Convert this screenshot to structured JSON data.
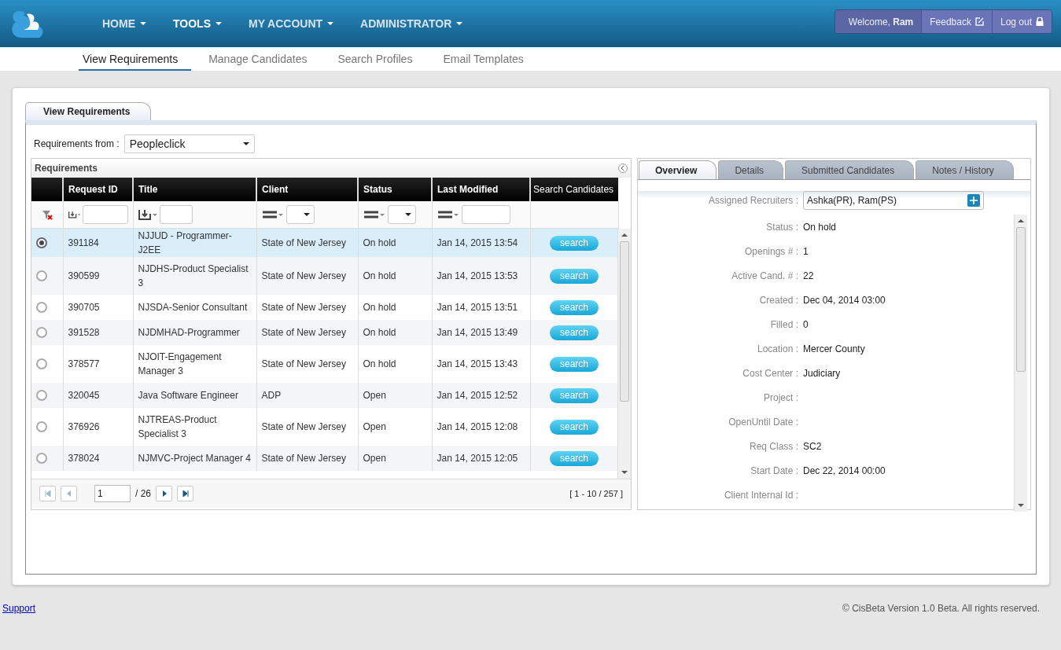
{
  "header": {
    "nav": [
      {
        "label": "HOME",
        "selected": false
      },
      {
        "label": "TOOLS",
        "selected": true
      },
      {
        "label": "MY ACCOUNT",
        "selected": false
      },
      {
        "label": "ADMINISTRATOR",
        "selected": false
      }
    ],
    "welcome": "Welcome, **Ram**",
    "feedback": "Feedback",
    "logout": "Log out"
  },
  "subnav": [
    {
      "label": "View Requirements",
      "selected": true
    },
    {
      "label": "Manage Candidates",
      "selected": false
    },
    {
      "label": "Search Profiles",
      "selected": false
    },
    {
      "label": "Email Templates",
      "selected": false
    }
  ],
  "page_tab": "View Requirements",
  "source": {
    "label": "Requirements from :",
    "value": "Peopleclick"
  },
  "grid": {
    "title": "Requirements",
    "columns": [
      {
        "kind": "clear"
      },
      {
        "label": "Request ID",
        "kind": "text"
      },
      {
        "label": "Title",
        "kind": "text"
      },
      {
        "label": "Client",
        "kind": "select"
      },
      {
        "label": "Status",
        "kind": "select"
      },
      {
        "label": "Last Modified",
        "kind": "date"
      },
      {
        "label": "Search Candidates",
        "kind": "none"
      }
    ],
    "rows": [
      {
        "selected": true,
        "request_id": "391184",
        "title": "NJJUD - Programmer-J2EE",
        "client": "State of New Jersey",
        "status": "On hold",
        "last_modified": "Jan 14, 2015 13:54",
        "action": "search"
      },
      {
        "selected": false,
        "request_id": "390599",
        "title": "NJDHS-Product Specialist 3",
        "client": "State of New Jersey",
        "status": "On hold",
        "last_modified": "Jan 14, 2015 13:53",
        "action": "search"
      },
      {
        "selected": false,
        "request_id": "390705",
        "title": "NJSDA-Senior Consultant",
        "client": "State of New Jersey",
        "status": "On hold",
        "last_modified": "Jan 14, 2015 13:51",
        "action": "search"
      },
      {
        "selected": false,
        "request_id": "391528",
        "title": "NJDMHAD-Programmer",
        "client": "State of New Jersey",
        "status": "On hold",
        "last_modified": "Jan 14, 2015 13:49",
        "action": "search"
      },
      {
        "selected": false,
        "request_id": "378577",
        "title": "NJOIT-Engagement Manager 3",
        "client": "State of New Jersey",
        "status": "On hold",
        "last_modified": "Jan 14, 2015 13:43",
        "action": "search"
      },
      {
        "selected": false,
        "request_id": "320045",
        "title": "Java Software Engineer",
        "client": "ADP",
        "status": "Open",
        "last_modified": "Jan 14, 2015 12:52",
        "action": "search"
      },
      {
        "selected": false,
        "request_id": "376926",
        "title": "NJTREAS-Product Specialist 3",
        "client": "State of New Jersey",
        "status": "Open",
        "last_modified": "Jan 14, 2015 12:08",
        "action": "search"
      },
      {
        "selected": false,
        "request_id": "378024",
        "title": "NJMVC-Project Manager 4",
        "client": "State of New Jersey",
        "status": "Open",
        "last_modified": "Jan 14, 2015 12:05",
        "action": "search"
      }
    ],
    "pager": {
      "page": "1",
      "total": "/ 26",
      "range": "[ 1 - 10 / 257 ]"
    }
  },
  "details": {
    "tabs": [
      {
        "label": "Overview",
        "selected": true
      },
      {
        "label": "Details",
        "selected": false
      },
      {
        "label": "Submitted Candidates",
        "selected": false
      },
      {
        "label": "Notes / History",
        "selected": false
      }
    ],
    "recruiters": {
      "label": "Assigned Recruiters :",
      "value": "Ashka(PR), Ram(PS)"
    },
    "fields": [
      {
        "label": "Status :",
        "value": "On hold"
      },
      {
        "label": "Openings # :",
        "value": "1"
      },
      {
        "label": "Active Cand. # :",
        "value": "22"
      },
      {
        "label": "Created :",
        "value": "Dec 04, 2014 03:00"
      },
      {
        "label": "Filled :",
        "value": "0"
      },
      {
        "label": "Location :",
        "value": "Mercer County"
      },
      {
        "label": "Cost Center :",
        "value": "Judiciary"
      },
      {
        "label": "Project :"
      },
      {
        "label": "OpenUntil Date :"
      },
      {
        "label": "Req Class :",
        "value": "SC2"
      },
      {
        "label": "Start Date :",
        "value": "Dec 22, 2014 00:00"
      },
      {
        "label": "Client Internal Id :"
      }
    ]
  },
  "footer": {
    "support": "Support",
    "copyright": "© CisBeta Version 1.0 Beta. All rights reserved."
  }
}
